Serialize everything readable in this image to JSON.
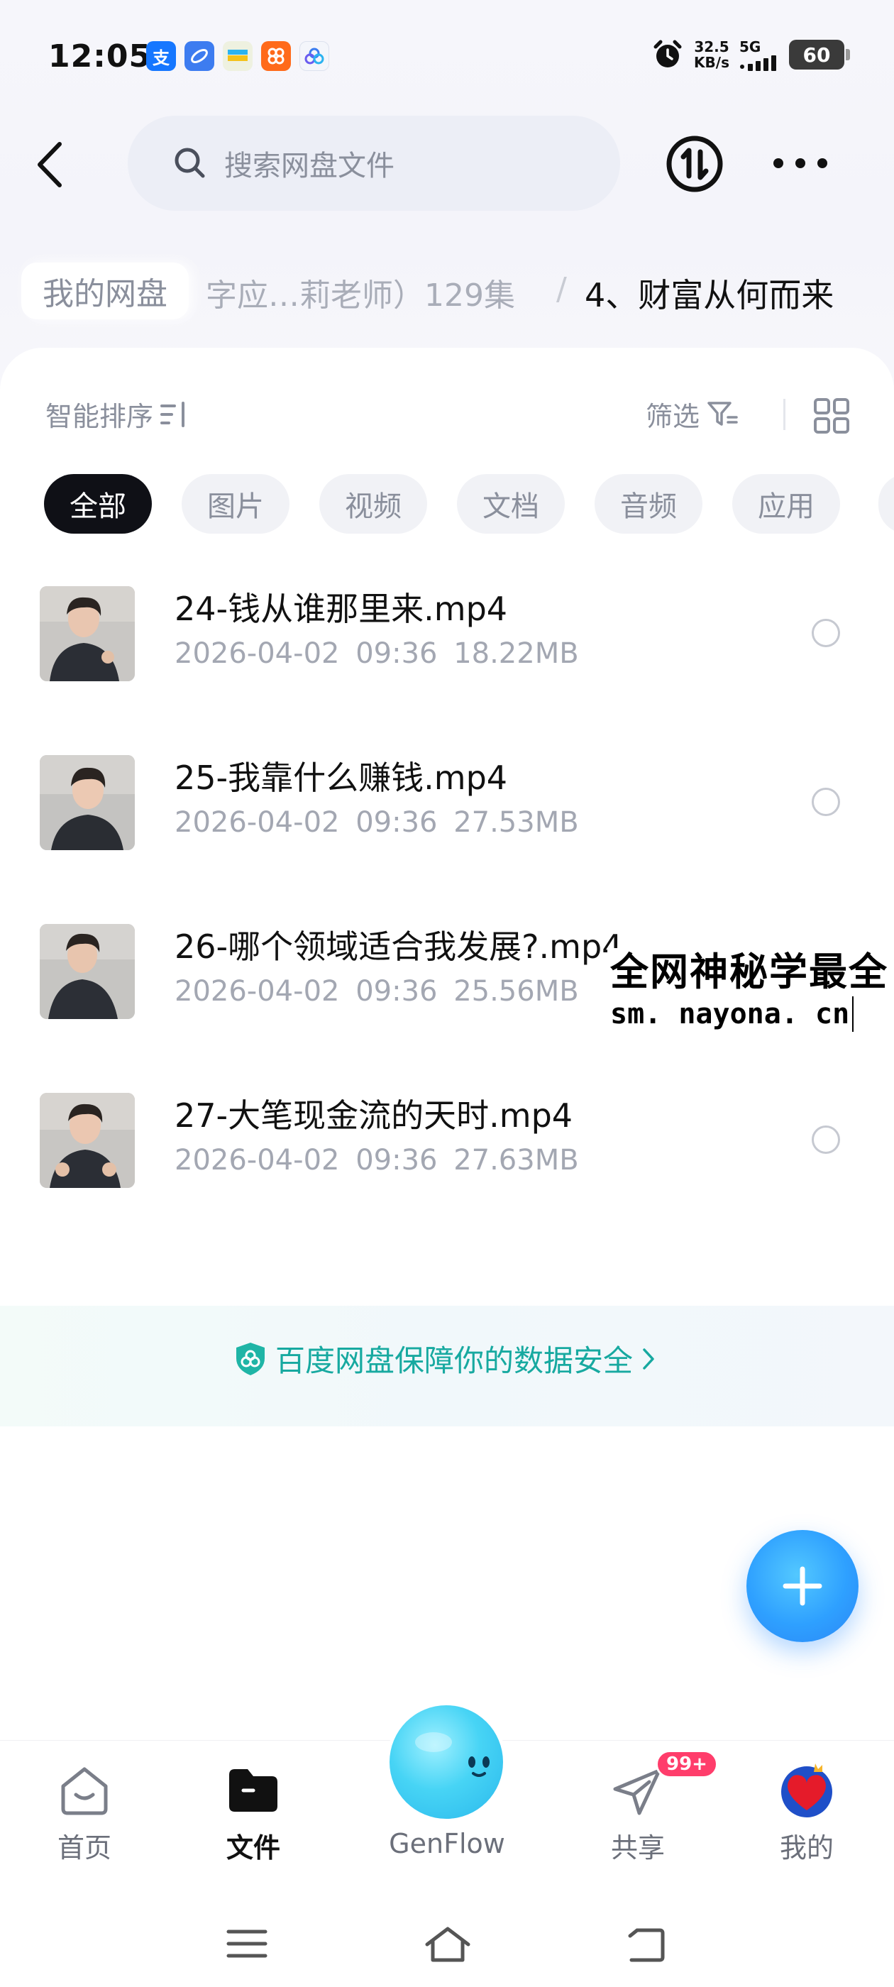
{
  "status_bar": {
    "time": "12:05",
    "net_speed_value": "32.5",
    "net_speed_unit": "KB/s",
    "signal": "5G",
    "battery": "60",
    "app_icons": [
      "alipay-icon",
      "browser-icon",
      "wallet-icon",
      "app-icon",
      "genflow-icon"
    ]
  },
  "header": {
    "search_placeholder": "搜索网盘文件"
  },
  "breadcrumb": {
    "root": "我的网盘",
    "middle": "字应…莉老师）129集",
    "separator": "/",
    "current": "4、财富从何而来"
  },
  "toolbar": {
    "sort_label": "智能排序",
    "filter_label": "筛选"
  },
  "tabs": [
    {
      "label": "全部",
      "active": true
    },
    {
      "label": "图片",
      "active": false
    },
    {
      "label": "视频",
      "active": false
    },
    {
      "label": "文档",
      "active": false
    },
    {
      "label": "音频",
      "active": false
    },
    {
      "label": "应用",
      "active": false
    }
  ],
  "files": [
    {
      "name": "24-钱从谁那里来.mp4",
      "date": "2026-04-02",
      "time": "09:36",
      "size": "18.22MB"
    },
    {
      "name": "25-我靠什么赚钱.mp4",
      "date": "2026-04-02",
      "time": "09:36",
      "size": "27.53MB"
    },
    {
      "name": "26-哪个领域适合我发展?.mp4",
      "date": "2026-04-02",
      "time": "09:36",
      "size": "25.56MB"
    },
    {
      "name": "27-大笔现金流的天时.mp4",
      "date": "2026-04-02",
      "time": "09:36",
      "size": "27.63MB"
    }
  ],
  "watermark": {
    "title": "全网神秘学最全",
    "url": "sm. nayona. cn"
  },
  "security_note": "百度网盘保障你的数据安全",
  "bottom_nav": {
    "home": "首页",
    "files": "文件",
    "genflow": "GenFlow",
    "share": "共享",
    "share_badge": "99+",
    "me": "我的"
  },
  "colors": {
    "accent": "#2ea0ff",
    "security_green": "#17a9a0",
    "badge_red": "#ff3d6b",
    "tab_active_bg": "#0f1016"
  }
}
